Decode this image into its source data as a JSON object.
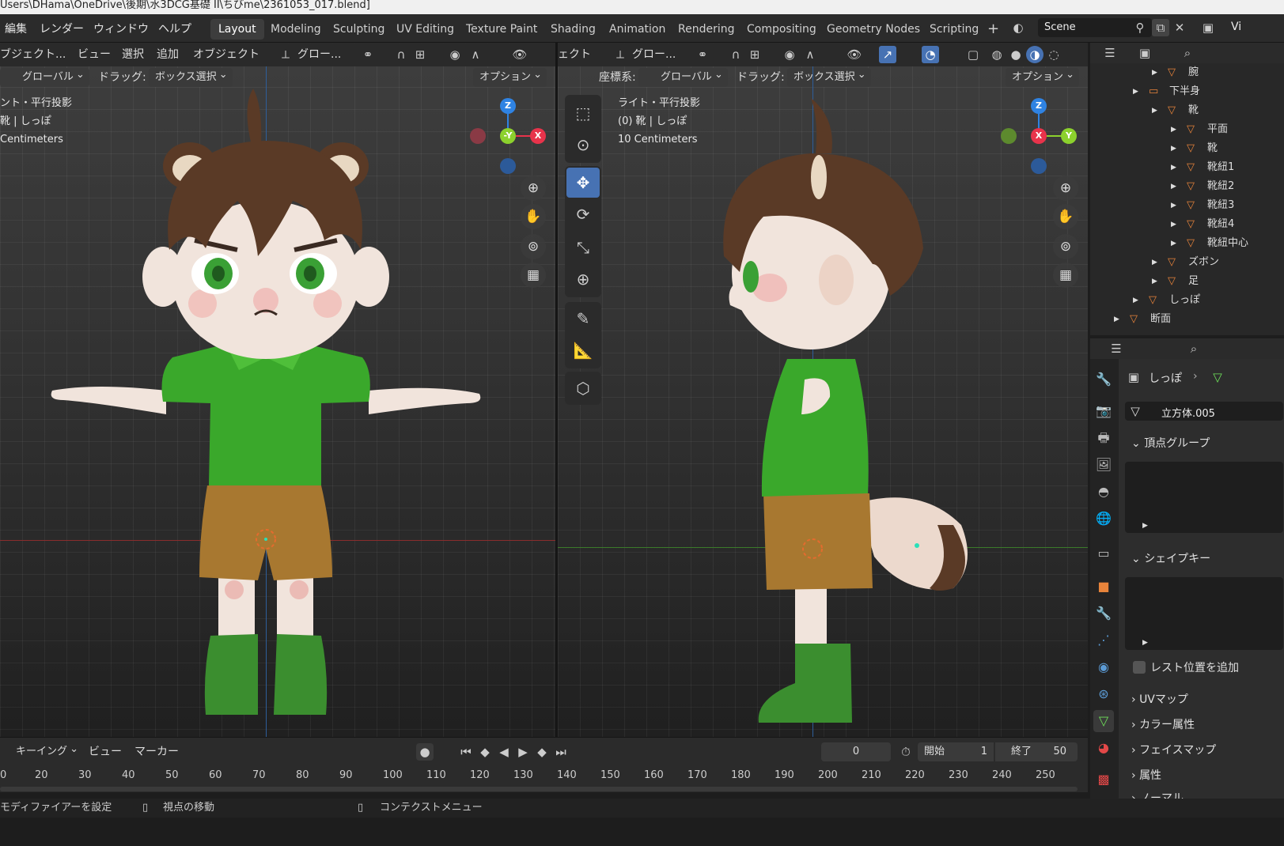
{
  "title_bar": {
    "path": "Users\\DHama\\OneDrive\\後期\\水3DCG基礎 II\\ちびme\\2361053_017.blend]"
  },
  "menu": [
    "編集",
    "レンダー",
    "ウィンドウ",
    "ヘルプ"
  ],
  "workspaces": [
    "Layout",
    "Modeling",
    "Sculpting",
    "UV Editing",
    "Texture Paint",
    "Shading",
    "Animation",
    "Rendering",
    "Compositing",
    "Geometry Nodes",
    "Scripting"
  ],
  "active_workspace": "Layout",
  "scene_name": "Scene",
  "view_layer_short": "Vi",
  "left_view": {
    "header": [
      "ブジェクト...",
      "ビュー",
      "選択",
      "追加",
      "オブジェクト"
    ],
    "transform": "グロー...",
    "orientation": "グローバル",
    "drag_label": "ドラッグ:",
    "drag_value": "ボックス選択",
    "options": "オプション",
    "overlay_lines": [
      "ント・平行投影",
      "靴 | しっぽ",
      "Centimeters"
    ]
  },
  "right_view": {
    "header_obj": "ェクト",
    "transform": "グロー...",
    "coord_label": "座標系:",
    "orientation": "グローバル",
    "drag_label": "ドラッグ:",
    "drag_value": "ボックス選択",
    "options": "オプション",
    "overlay_lines": [
      "ライト・平行投影",
      "(0) 靴 | しっぽ",
      "10 Centimeters"
    ]
  },
  "gizmo_left": {
    "z": "Z",
    "y": "-Y",
    "x": "X"
  },
  "gizmo_right": {
    "z": "Z",
    "x": "X",
    "y": "Y"
  },
  "outliner": [
    {
      "label": "腕",
      "depth": 3
    },
    {
      "label": "下半身",
      "depth": 2
    },
    {
      "label": "靴",
      "depth": 3
    },
    {
      "label": "平面",
      "depth": 4
    },
    {
      "label": "靴",
      "depth": 4
    },
    {
      "label": "靴紐1",
      "depth": 4
    },
    {
      "label": "靴紐2",
      "depth": 4
    },
    {
      "label": "靴紐3",
      "depth": 4
    },
    {
      "label": "靴紐4",
      "depth": 4
    },
    {
      "label": "靴紐中心",
      "depth": 4
    },
    {
      "label": "ズボン",
      "depth": 3
    },
    {
      "label": "足",
      "depth": 3
    },
    {
      "label": "しっぽ",
      "depth": 2
    },
    {
      "label": "断面",
      "depth": 1
    }
  ],
  "properties": {
    "object_name": "しっぽ",
    "mesh_name": "立方体.005",
    "vertex_groups": "頂点グループ",
    "shape_keys": "シェイプキー",
    "add_rest_position": "レスト位置を追加",
    "uv_maps": "UVマップ",
    "color_attributes": "カラー属性",
    "face_maps": "フェイスマップ",
    "attributes": "属性",
    "normals_cut": "ノーマル"
  },
  "timeline": {
    "keying": "キーイング",
    "view": "ビュー",
    "marker": "マーカー",
    "current_frame": "0",
    "start_label": "開始",
    "start": "1",
    "end_label": "終了",
    "end": "50",
    "ticks": [
      "0",
      "20",
      "30",
      "40",
      "50",
      "60",
      "70",
      "80",
      "90",
      "100",
      "110",
      "120",
      "130",
      "140",
      "150",
      "160",
      "170",
      "180",
      "190",
      "200",
      "210",
      "220",
      "230",
      "240",
      "250"
    ]
  },
  "status": {
    "left": "モディファイアーを設定",
    "middle": "視点の移動",
    "right": "コンテクストメニュー"
  },
  "colors": {
    "accent": "#4772b3",
    "axis_x": "#e8334b",
    "axis_y": "#8cd12d",
    "axis_z": "#2f83e3",
    "shirt": "#3aa82b",
    "shorts": "#a87830",
    "hair": "#5a3a26"
  }
}
